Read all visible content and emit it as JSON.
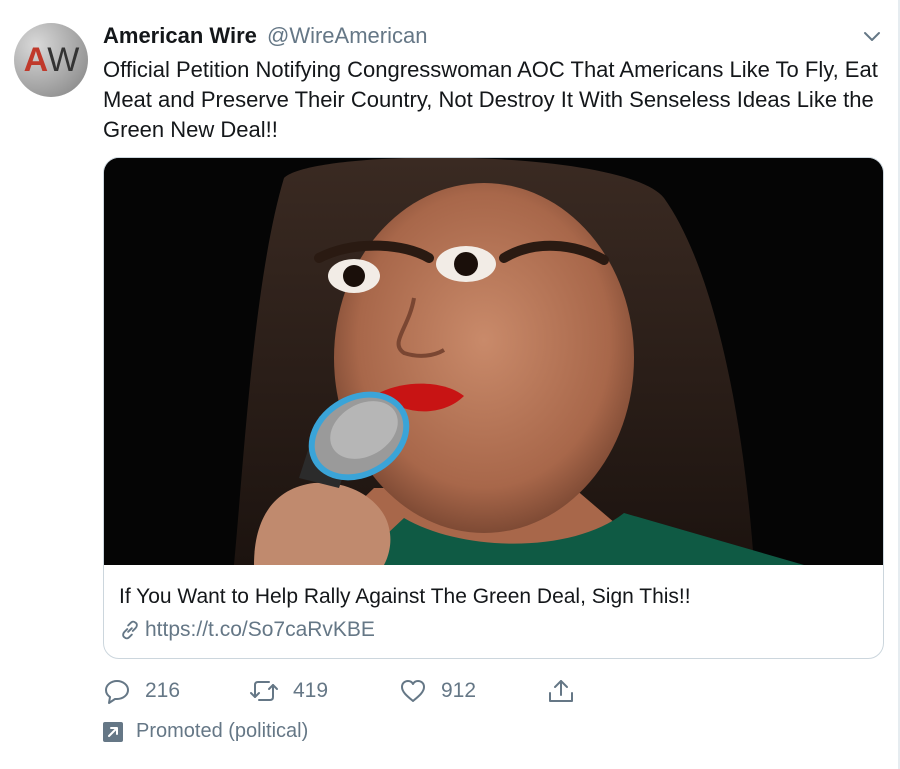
{
  "tweet": {
    "avatar_text_a": "A",
    "avatar_text_w": "W",
    "author_name": "American Wire",
    "author_handle": "@WireAmerican",
    "text": "Official Petition Notifying Congresswoman AOC That Americans Like To Fly, Eat Meat and Preserve Their Country, Not Destroy It With Senseless Ideas Like the Green New Deal!!"
  },
  "card": {
    "title": "If You Want to Help Rally Against The Green Deal, Sign This!!",
    "link": "https://t.co/So7caRvKBE",
    "image_icon": "portrait-photo"
  },
  "actions": {
    "replies": "216",
    "retweets": "419",
    "likes": "912"
  },
  "promoted_label": "Promoted (political)",
  "colors": {
    "secondary_text": "#657786",
    "border": "#ccd6dd",
    "dress_green": "#0f5a44",
    "lips_red": "#c81414"
  }
}
